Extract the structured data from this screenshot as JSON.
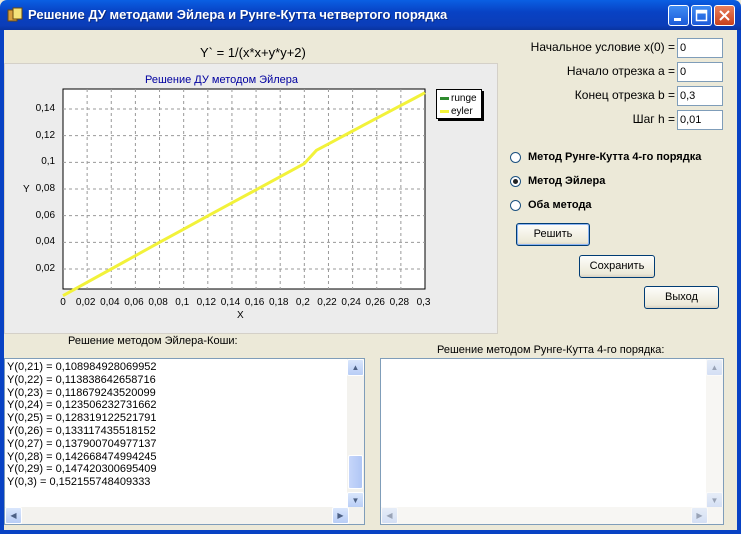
{
  "window": {
    "title": "Решение ДУ методами Эйлера и Рунге-Кутта четвертого порядка",
    "icons": [
      "app-icon",
      "minimize-icon",
      "maximize-icon",
      "close-icon"
    ]
  },
  "formula": "Y` = 1/(x*x+y*y+2)",
  "params": {
    "x0_label": "Начальное условие x(0) =",
    "x0_value": "0",
    "a_label": "Начало отрезка a =",
    "a_value": "0",
    "b_label": "Конец отрезка b =",
    "b_value": "0,3",
    "h_label": "Шаг h =",
    "h_value": "0,01"
  },
  "methods": {
    "options": [
      {
        "label": "Метод Рунге-Кутта 4-го порядка",
        "selected": false
      },
      {
        "label": "Метод Эйлера",
        "selected": true
      },
      {
        "label": "Оба метода",
        "selected": false
      }
    ]
  },
  "buttons": {
    "solve": "Решить",
    "save": "Сохранить",
    "exit": "Выход"
  },
  "euler_panel": {
    "caption": "Решение методом Эйлера-Коши:",
    "lines": [
      "Y(0,21) = 0,108984928069952",
      "Y(0,22) = 0,113838642658716",
      "Y(0,23) = 0,118679243520099",
      "Y(0,24) = 0,123506232731662",
      "Y(0,25) = 0,128319122521791",
      "Y(0,26) = 0,133117435518152",
      "Y(0,27) = 0,137900704977137",
      "Y(0,28) = 0,142668474994245",
      "Y(0,29) = 0,147420300695409",
      "Y(0,3) = 0,152155748409333"
    ]
  },
  "rk_panel": {
    "caption": "Решение методом Рунге-Кутта 4-го порядка:",
    "lines": []
  },
  "chart_data": {
    "type": "line",
    "title": "Решение ДУ методом Эйлера",
    "xlabel": "X",
    "ylabel": "Y",
    "xlim": [
      0,
      0.3
    ],
    "ylim": [
      0.005,
      0.155
    ],
    "grid": true,
    "legend_position": "top-right",
    "x_ticks": [
      "0",
      "0,02",
      "0,04",
      "0,06",
      "0,08",
      "0,1",
      "0,12",
      "0,14",
      "0,16",
      "0,18",
      "0,2",
      "0,22",
      "0,24",
      "0,26",
      "0,28",
      "0,3"
    ],
    "y_ticks": [
      "0,02",
      "0,04",
      "0,06",
      "0,08",
      "0,1",
      "0,12",
      "0,14"
    ],
    "series": [
      {
        "name": "runge",
        "color": "#2e8b2e",
        "x": [],
        "y": []
      },
      {
        "name": "eyler",
        "color": "#f2f23a",
        "x": [
          0,
          0.02,
          0.04,
          0.06,
          0.08,
          0.1,
          0.12,
          0.14,
          0.16,
          0.18,
          0.2,
          0.21,
          0.22,
          0.23,
          0.24,
          0.25,
          0.26,
          0.27,
          0.28,
          0.29,
          0.3
        ],
        "y": [
          0,
          0.01,
          0.02,
          0.03,
          0.04,
          0.0499,
          0.0598,
          0.0696,
          0.0794,
          0.0892,
          0.0991,
          0.109,
          0.1138,
          0.1187,
          0.1235,
          0.1283,
          0.1331,
          0.1379,
          0.1427,
          0.1474,
          0.1522
        ]
      }
    ]
  }
}
